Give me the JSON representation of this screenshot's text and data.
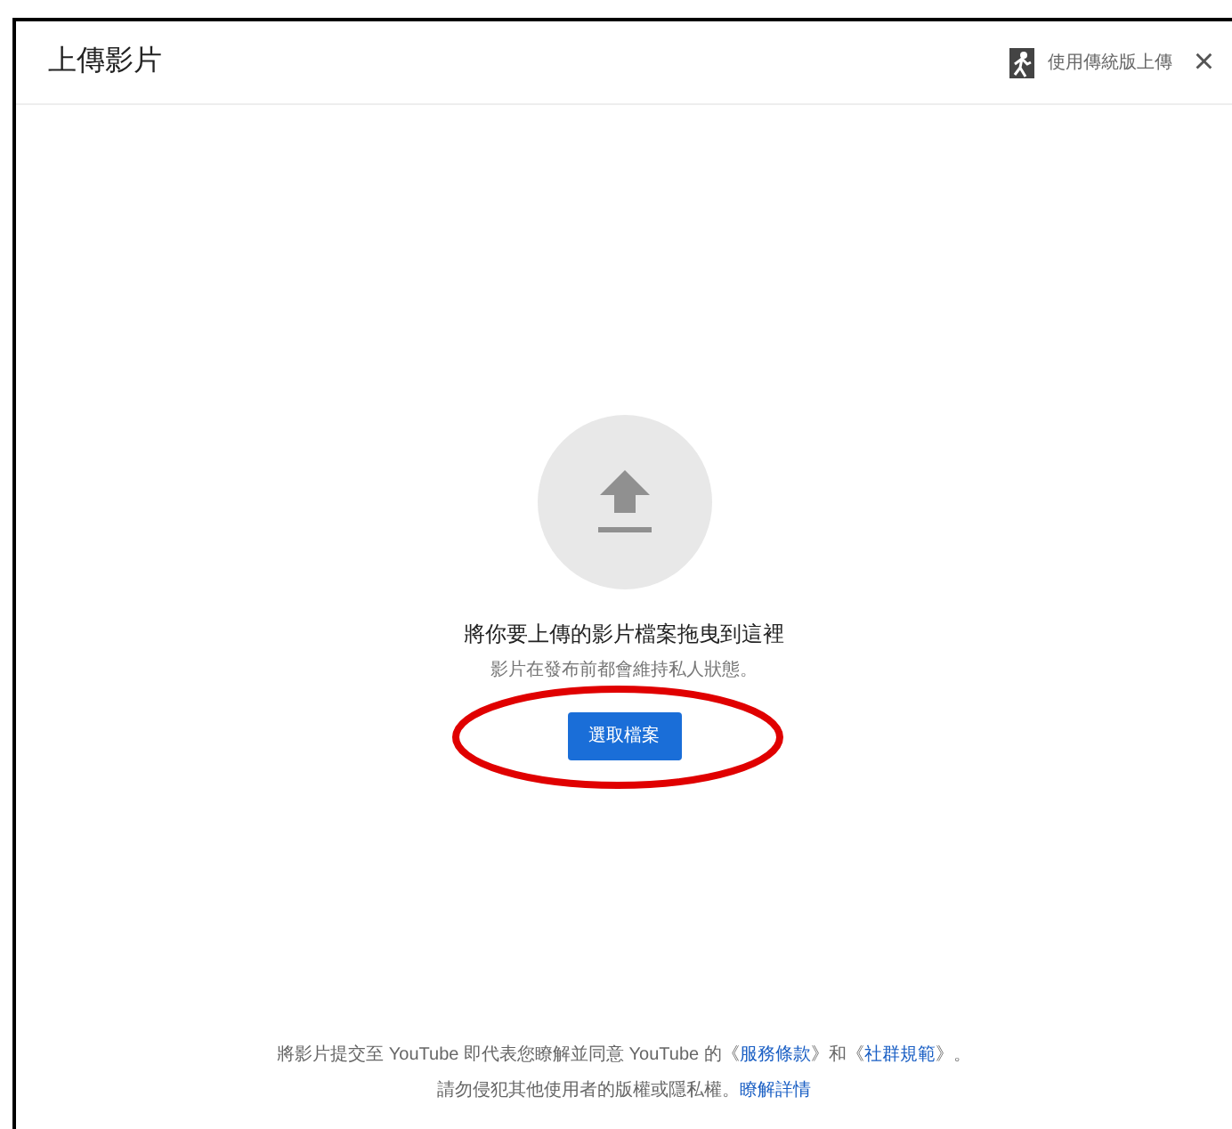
{
  "dialog": {
    "title": "上傳影片",
    "classic_upload": "使用傳統版上傳",
    "close": "×"
  },
  "drop_zone": {
    "heading": "將你要上傳的影片檔案拖曳到這裡",
    "note": "影片在發布前都會維持私人狀態。",
    "button": "選取檔案"
  },
  "footer": {
    "lines": [
      [
        {
          "kind": "text",
          "text": "將影片提交至 YouTube 即代表您瞭解並同意 YouTube 的《"
        },
        {
          "kind": "link",
          "text": "服務條款"
        },
        {
          "kind": "text",
          "text": "》和《"
        },
        {
          "kind": "link",
          "text": "社群規範"
        },
        {
          "kind": "text",
          "text": "》。"
        }
      ],
      [
        {
          "kind": "text",
          "text": "請勿侵犯其他使用者的版權或隱私權。"
        },
        {
          "kind": "link",
          "text": "瞭解詳情"
        }
      ]
    ]
  }
}
